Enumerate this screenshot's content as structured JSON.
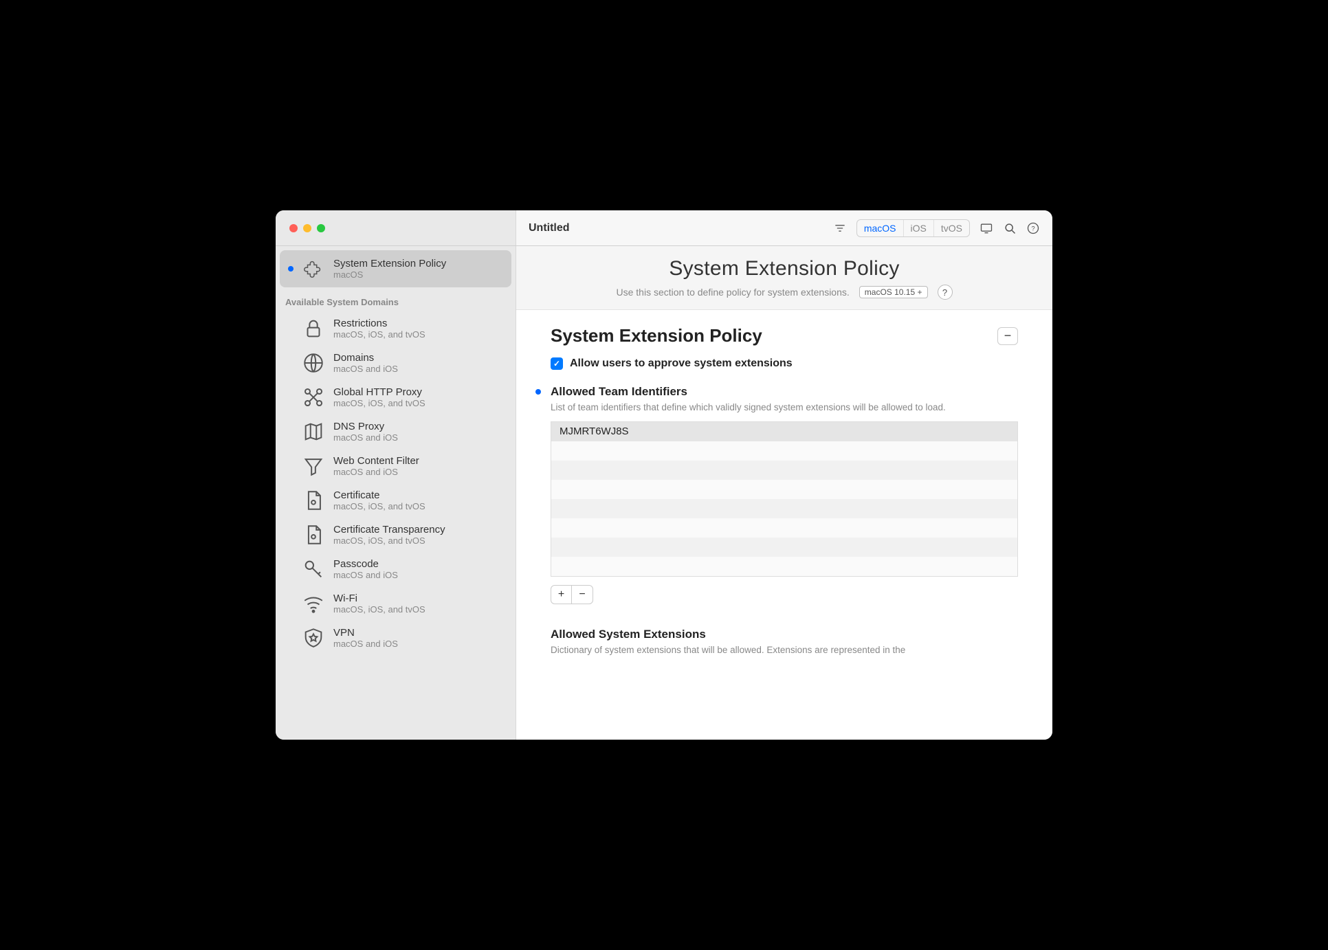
{
  "window": {
    "title": "Untitled",
    "platforms": [
      "macOS",
      "iOS",
      "tvOS"
    ],
    "active_platform": "macOS"
  },
  "sidebar": {
    "selected": {
      "name": "System Extension Policy",
      "sub": "macOS"
    },
    "section_label": "Available System Domains",
    "items": [
      {
        "name": "Restrictions",
        "sub": "macOS, iOS, and tvOS",
        "icon": "lock"
      },
      {
        "name": "Domains",
        "sub": "macOS and iOS",
        "icon": "globe"
      },
      {
        "name": "Global HTTP Proxy",
        "sub": "macOS, iOS, and tvOS",
        "icon": "proxy"
      },
      {
        "name": "DNS Proxy",
        "sub": "macOS and iOS",
        "icon": "map"
      },
      {
        "name": "Web Content Filter",
        "sub": "macOS and iOS",
        "icon": "funnel"
      },
      {
        "name": "Certificate",
        "sub": "macOS, iOS, and tvOS",
        "icon": "cert"
      },
      {
        "name": "Certificate Transparency",
        "sub": "macOS, iOS, and tvOS",
        "icon": "cert"
      },
      {
        "name": "Passcode",
        "sub": "macOS and iOS",
        "icon": "key"
      },
      {
        "name": "Wi-Fi",
        "sub": "macOS, iOS, and tvOS",
        "icon": "wifi"
      },
      {
        "name": "VPN",
        "sub": "macOS and iOS",
        "icon": "shield"
      }
    ]
  },
  "content": {
    "header_title": "System Extension Policy",
    "header_subtitle": "Use this section to define policy for system extensions.",
    "min_os": "macOS  10.15 +",
    "section_title": "System Extension Policy",
    "checkbox_label": "Allow users to approve system extensions",
    "checkbox_checked": true,
    "team_ids": {
      "title": "Allowed Team Identifiers",
      "desc": "List of team identifiers that define which validly signed system extensions will be allowed to load.",
      "rows": [
        "MJMRT6WJ8S",
        "",
        "",
        "",
        "",
        "",
        "",
        ""
      ]
    },
    "allowed_ext": {
      "title": "Allowed System Extensions",
      "desc": "Dictionary of system extensions that will be allowed. Extensions are represented in the"
    },
    "plus": "+",
    "minus": "−"
  }
}
